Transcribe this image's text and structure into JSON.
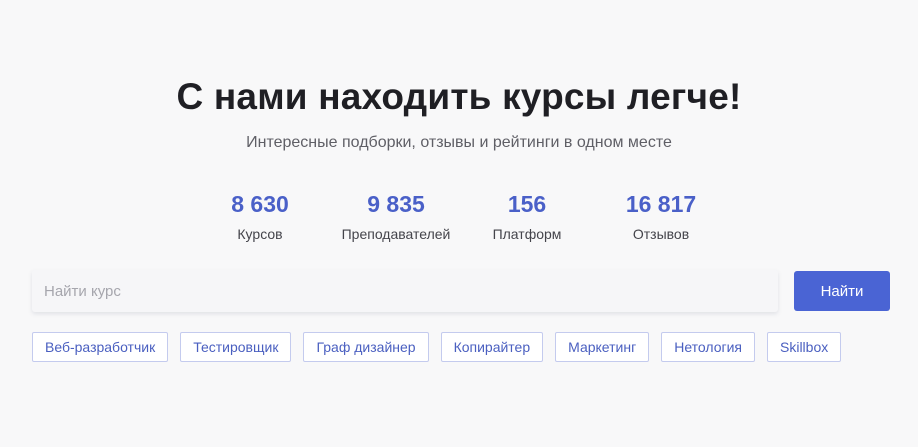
{
  "hero": {
    "title": "С нами находить курсы легче!",
    "subtitle": "Интересные подборки, отзывы и рейтинги в одном месте"
  },
  "stats": [
    {
      "value": "8 630",
      "label": "Курсов"
    },
    {
      "value": "9 835",
      "label": "Преподавателей"
    },
    {
      "value": "156",
      "label": "Платформ"
    },
    {
      "value": "16 817",
      "label": "Отзывов"
    }
  ],
  "search": {
    "placeholder": "Найти курс",
    "value": "",
    "button_label": "Найти"
  },
  "tags": [
    "Веб-разработчик",
    "Тестировщик",
    "Граф дизайнер",
    "Копирайтер",
    "Маркетинг",
    "Нетология",
    "Skillbox"
  ],
  "colors": {
    "accent": "#4a64d4",
    "stat_number": "#4a60c8",
    "background": "#f8f8f9"
  }
}
